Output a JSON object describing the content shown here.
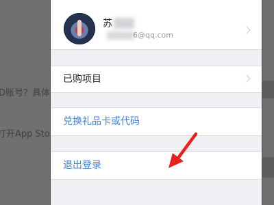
{
  "background": {
    "line1": "D账号？具体",
    "line2": "打开App Store"
  },
  "account": {
    "name": "苏",
    "email": "6@qq.com"
  },
  "menu": {
    "purchased": "已购项目",
    "redeem": "兑换礼品卡或代码",
    "sign_out": "退出登录"
  },
  "colors": {
    "link": "#3b82d8",
    "arrow": "#e8211c",
    "sheet_bg": "#efeff4"
  },
  "icons": {
    "chevron": "chevron-right-icon",
    "annotation": "red-arrow-icon"
  }
}
